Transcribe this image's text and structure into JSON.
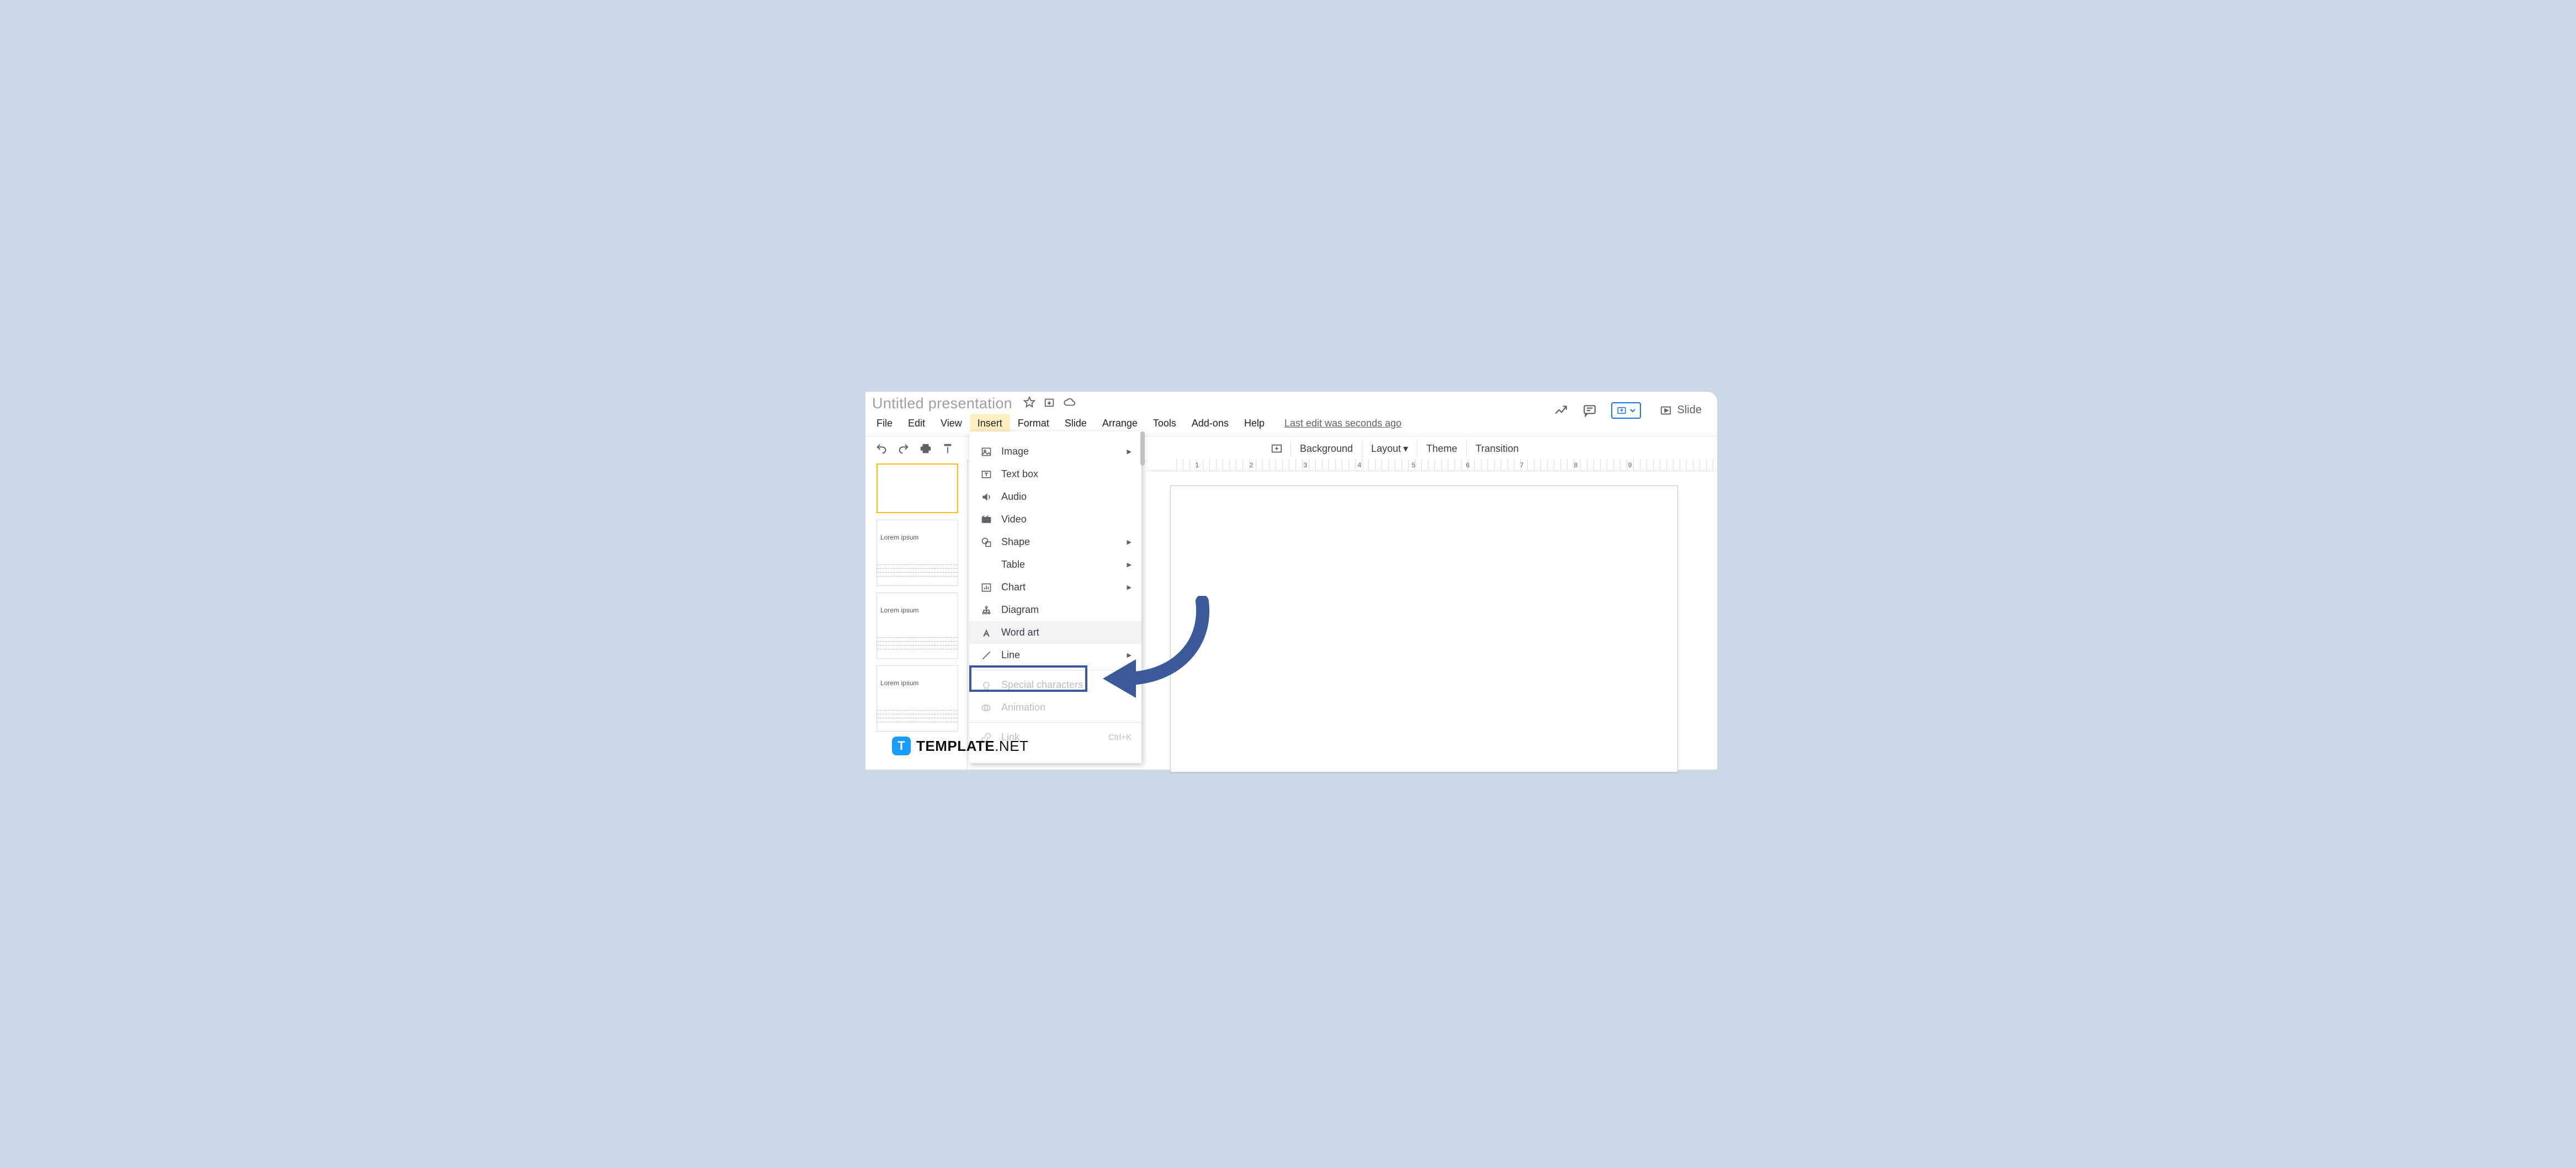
{
  "doc_title": "Untitled presentation",
  "menubar": {
    "file": "File",
    "edit": "Edit",
    "view": "View",
    "insert": "Insert",
    "format": "Format",
    "slide": "Slide",
    "arrange": "Arrange",
    "tools": "Tools",
    "addons": "Add-ons",
    "help": "Help"
  },
  "last_edit": "Last edit was seconds ago",
  "slideshow_label": "Slide",
  "toolbar": {
    "background": "Background",
    "layout": "Layout",
    "theme": "Theme",
    "transition": "Transition"
  },
  "ruler_numbers": [
    "1",
    "2",
    "3",
    "4",
    "5",
    "6",
    "7",
    "8",
    "9"
  ],
  "thumb_label": "Lorem ipsum",
  "insert_menu": {
    "image": "Image",
    "textbox": "Text box",
    "audio": "Audio",
    "video": "Video",
    "shape": "Shape",
    "table": "Table",
    "chart": "Chart",
    "diagram": "Diagram",
    "wordart": "Word art",
    "line": "Line",
    "special": "Special characters",
    "animation": "Animation",
    "link": "Link",
    "link_shortcut": "Ctrl+K"
  },
  "watermark": {
    "badge": "T",
    "name1": "TEMPLATE",
    "name2": ".NET"
  }
}
